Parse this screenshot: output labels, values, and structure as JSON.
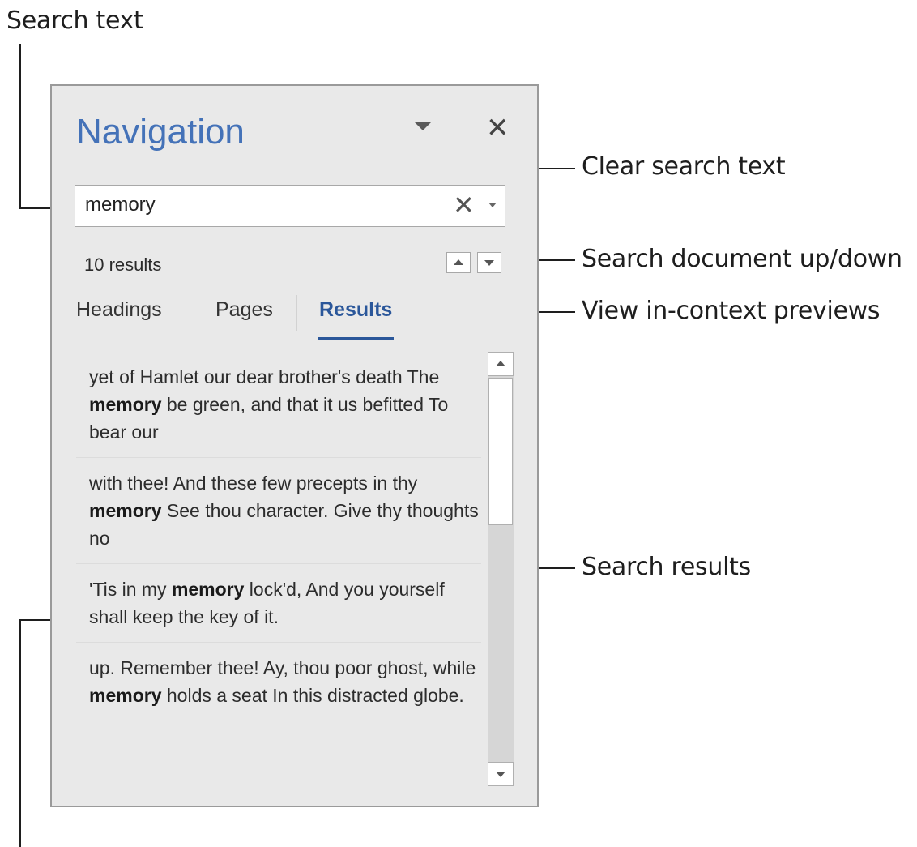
{
  "callouts": {
    "search_text": "Search text",
    "clear_search_text": "Clear search text",
    "search_up_down": "Search document up/down",
    "view_previews": "View in-context previews",
    "search_results": "Search results"
  },
  "pane": {
    "title": "Navigation",
    "close_glyph": "✕",
    "search": {
      "value": "memory",
      "clear_glyph": "✕"
    },
    "result_count": "10 results",
    "tabs": [
      {
        "label": "Headings",
        "active": false
      },
      {
        "label": "Pages",
        "active": false
      },
      {
        "label": "Results",
        "active": true
      }
    ],
    "results": [
      {
        "before": "yet of Hamlet our dear brother's death The ",
        "match": "memory",
        "after": " be green, and that it us befitted To bear our"
      },
      {
        "before": "with thee! And these few precepts in thy ",
        "match": "memory",
        "after": " See thou character. Give thy thoughts no"
      },
      {
        "before": "'Tis in my ",
        "match": "memory",
        "after": " lock'd, And you yourself shall keep the key of it."
      },
      {
        "before": "up. Remember thee! Ay, thou poor ghost, while ",
        "match": "memory",
        "after": " holds a seat In this distracted globe."
      }
    ]
  },
  "colors": {
    "title_blue": "#4472b8",
    "active_tab_blue": "#2b579a",
    "pane_background": "#e9e9e9"
  },
  "icons": {
    "dropdown": "chevron-down-icon",
    "close": "close-icon",
    "clear": "clear-icon",
    "previous": "arrow-up-icon",
    "next": "arrow-down-icon"
  }
}
